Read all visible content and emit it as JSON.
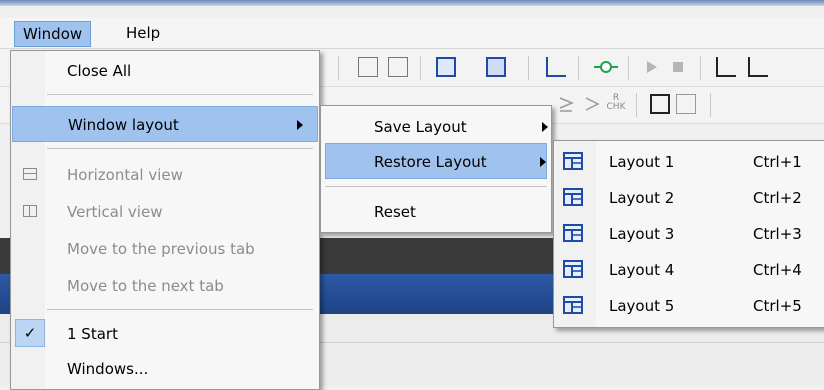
{
  "menubar": {
    "window_label": "Window",
    "help_label": "Help"
  },
  "window_menu": {
    "items": [
      {
        "label": "Close All"
      },
      {
        "label": "Window layout"
      },
      {
        "label": "Horizontal view"
      },
      {
        "label": "Vertical view"
      },
      {
        "label": "Move to the previous tab"
      },
      {
        "label": "Move to the next tab"
      },
      {
        "label": "1 Start"
      },
      {
        "label": "Windows..."
      }
    ]
  },
  "layout_menu": {
    "items": [
      {
        "label": "Save Layout"
      },
      {
        "label": "Restore Layout"
      },
      {
        "label": "Reset"
      }
    ]
  },
  "restore_menu": {
    "items": [
      {
        "label": "Layout 1",
        "shortcut": "Ctrl+1"
      },
      {
        "label": "Layout 2",
        "shortcut": "Ctrl+2"
      },
      {
        "label": "Layout 3",
        "shortcut": "Ctrl+3"
      },
      {
        "label": "Layout 4",
        "shortcut": "Ctrl+4"
      },
      {
        "label": "Layout 5",
        "shortcut": "Ctrl+5"
      }
    ]
  },
  "toolbar": {
    "chk_icon_text": "CHK",
    "chk_icon_letter": "R"
  },
  "colors": {
    "highlight": "#9fc3ee",
    "disabled_text": "#8c8c8c",
    "band_dark": "#3a3a3a",
    "band_blue": "#2d5aa6",
    "icon_blue": "#1e4aa8",
    "icon_green": "#1aa34a"
  }
}
